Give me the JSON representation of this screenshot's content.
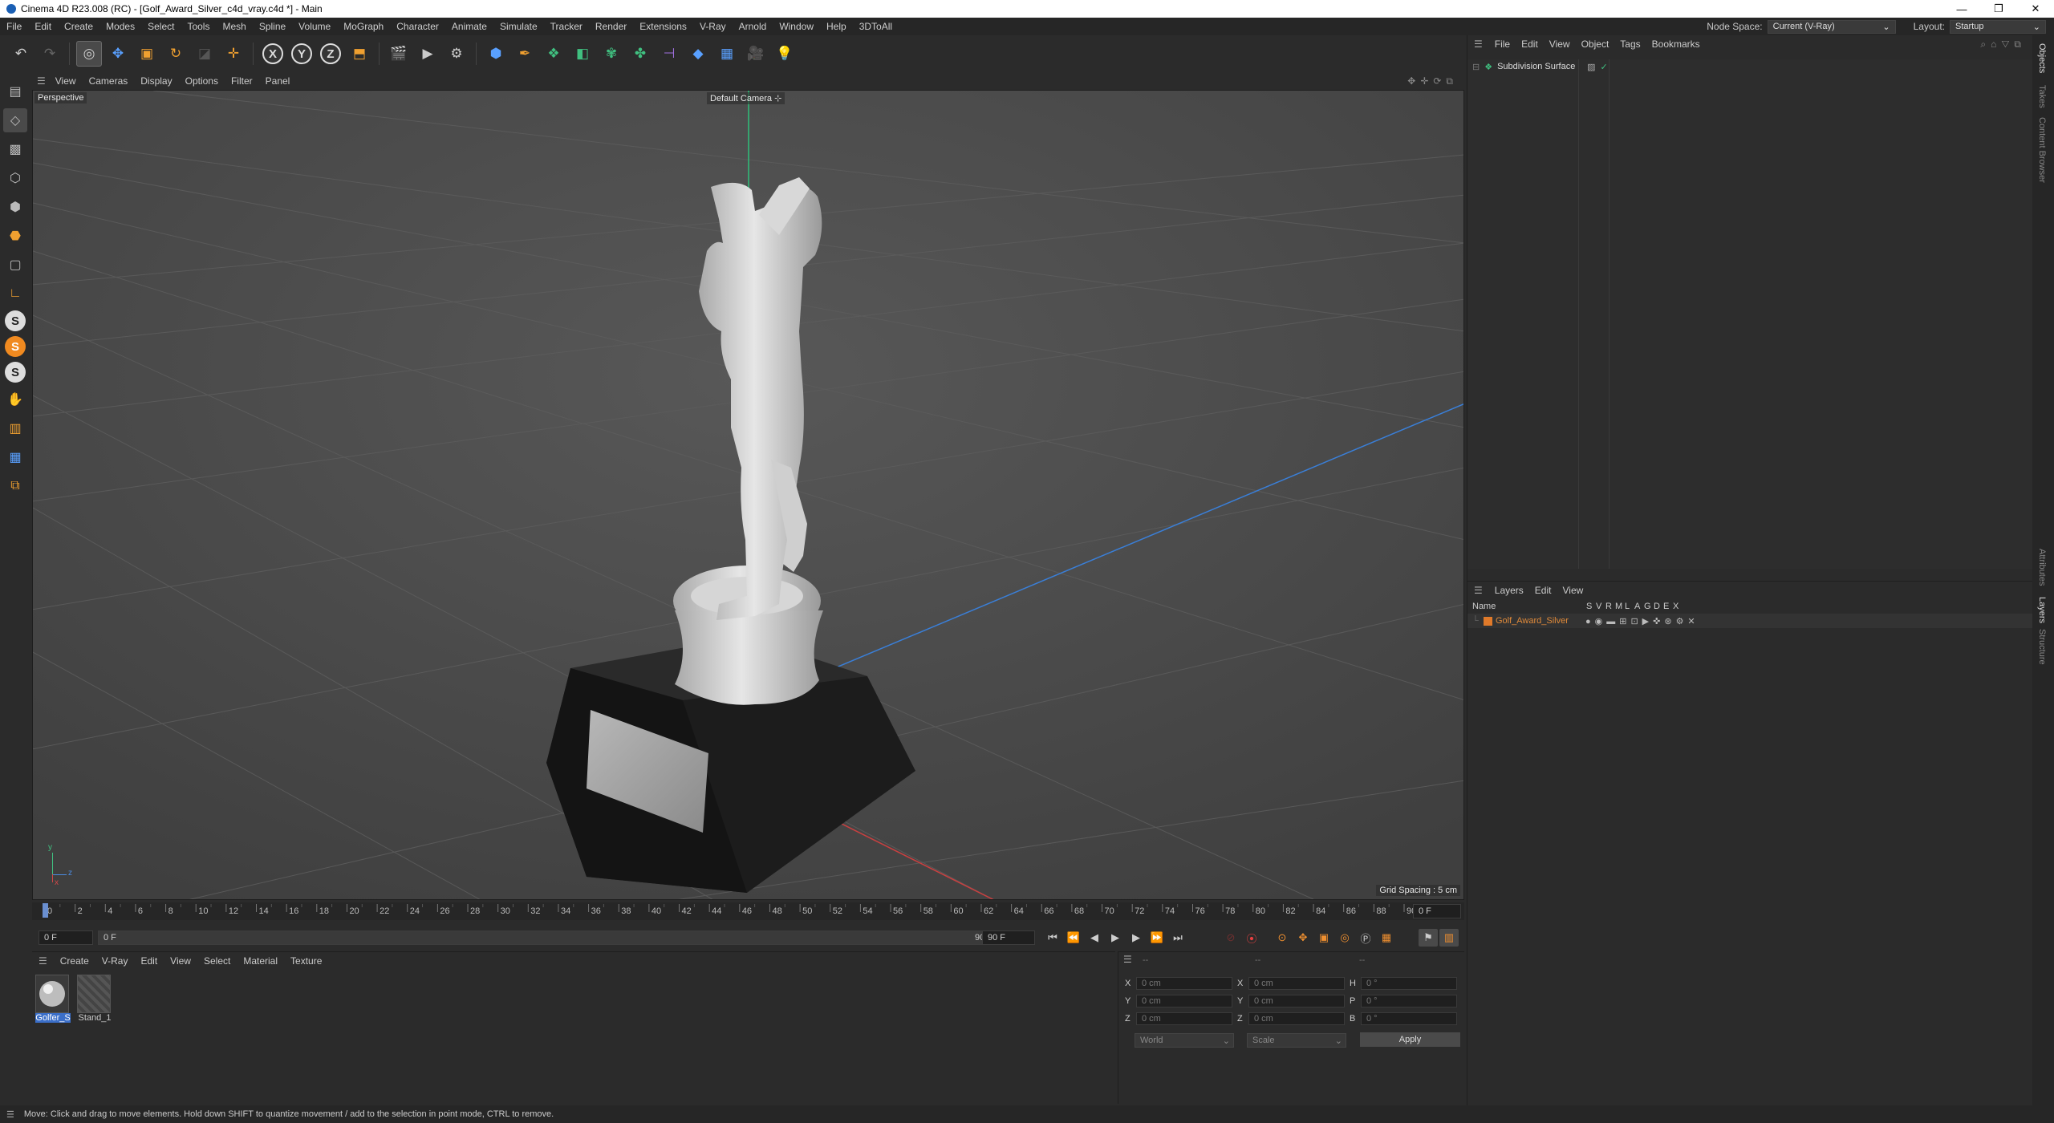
{
  "window": {
    "title": "Cinema 4D R23.008 (RC) - [Golf_Award_Silver_c4d_vray.c4d *] - Main",
    "controls": [
      "—",
      "❐",
      "✕"
    ]
  },
  "menu": {
    "items": [
      "File",
      "Edit",
      "Create",
      "Modes",
      "Select",
      "Tools",
      "Mesh",
      "Spline",
      "Volume",
      "MoGraph",
      "Character",
      "Animate",
      "Simulate",
      "Tracker",
      "Render",
      "Extensions",
      "V-Ray",
      "Arnold",
      "Window",
      "Help",
      "3DToAll"
    ],
    "node_space_label": "Node Space:",
    "node_space_value": "Current (V-Ray)",
    "layout_label": "Layout:",
    "layout_value": "Startup"
  },
  "viewport": {
    "menu": [
      "View",
      "Cameras",
      "Display",
      "Options",
      "Filter",
      "Panel"
    ],
    "name": "Perspective",
    "camera": "Default Camera",
    "grid_spacing": "Grid Spacing : 5 cm",
    "axis_labels": [
      "y",
      "z",
      "x"
    ]
  },
  "timeline": {
    "ticks": [
      "0",
      "2",
      "4",
      "6",
      "8",
      "10",
      "12",
      "14",
      "16",
      "18",
      "20",
      "22",
      "24",
      "26",
      "28",
      "30",
      "32",
      "34",
      "36",
      "38",
      "40",
      "42",
      "44",
      "46",
      "48",
      "50",
      "52",
      "54",
      "56",
      "58",
      "60",
      "62",
      "64",
      "66",
      "68",
      "70",
      "72",
      "74",
      "76",
      "78",
      "80",
      "82",
      "84",
      "86",
      "88",
      "90"
    ],
    "current_frame_field": "0 F",
    "start_field": "0 F",
    "range_start": "0 F",
    "range_end": "90 F",
    "end_field": "90 F"
  },
  "material_manager": {
    "menu": [
      "Create",
      "V-Ray",
      "Edit",
      "View",
      "Select",
      "Material",
      "Texture"
    ],
    "materials": [
      {
        "name": "Golfer_S",
        "selected": true
      },
      {
        "name": "Stand_1",
        "selected": false
      }
    ]
  },
  "coordinates": {
    "header": [
      "--",
      "--",
      "--"
    ],
    "rows": [
      {
        "l1": "X",
        "v1": "0 cm",
        "l2": "X",
        "v2": "0 cm",
        "l3": "H",
        "v3": "0 °"
      },
      {
        "l1": "Y",
        "v1": "0 cm",
        "l2": "Y",
        "v2": "0 cm",
        "l3": "P",
        "v3": "0 °"
      },
      {
        "l1": "Z",
        "v1": "0 cm",
        "l2": "Z",
        "v2": "0 cm",
        "l3": "B",
        "v3": "0 °"
      }
    ],
    "mode1": "World",
    "mode2": "Scale",
    "apply": "Apply"
  },
  "objects_panel": {
    "menu": [
      "File",
      "Edit",
      "View",
      "Object",
      "Tags",
      "Bookmarks"
    ],
    "items": [
      {
        "name": "Subdivision Surface"
      }
    ]
  },
  "layers_panel": {
    "menu": [
      "Layers",
      "Edit",
      "View"
    ],
    "columns": [
      "Name",
      "S",
      "V",
      "R",
      "M",
      "L",
      "A",
      "G",
      "D",
      "E",
      "X"
    ],
    "items": [
      {
        "name": "Golf_Award_Silver",
        "color": "#e07a2a"
      }
    ]
  },
  "side_tabs": [
    "Objects",
    "Takes",
    "Content Browser",
    "Attributes",
    "Layers",
    "Structure"
  ],
  "status": "Move: Click and drag to move elements. Hold down SHIFT to quantize movement / add to the selection in point mode, CTRL to remove.",
  "colors": {
    "accent": "#3b6fc9",
    "layer_orange": "#e07a2a",
    "record_red": "#e84040"
  }
}
